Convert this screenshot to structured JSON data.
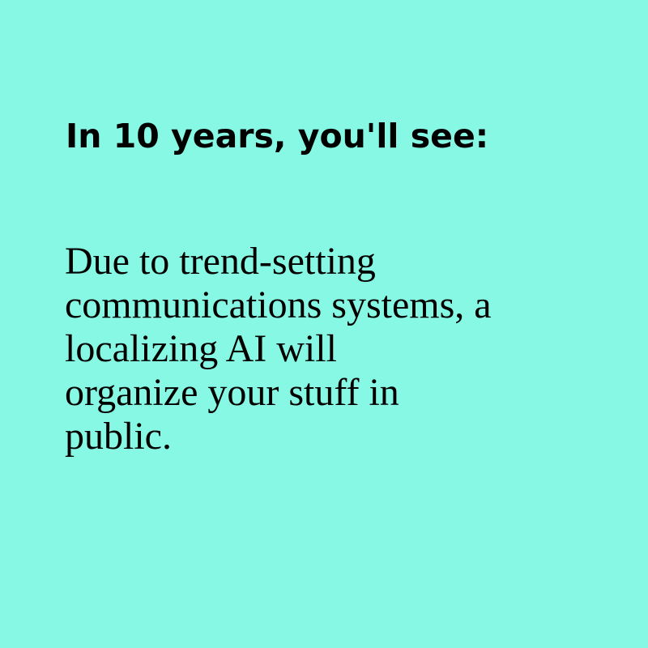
{
  "colors": {
    "background": "#87f8e3",
    "text": "#000000"
  },
  "headline": "In 10 years, you'll see:",
  "body": {
    "lines": [
      "Due to trend-setting",
      "communications systems, a",
      "localizing AI will",
      "organize your stuff in",
      "public."
    ]
  }
}
